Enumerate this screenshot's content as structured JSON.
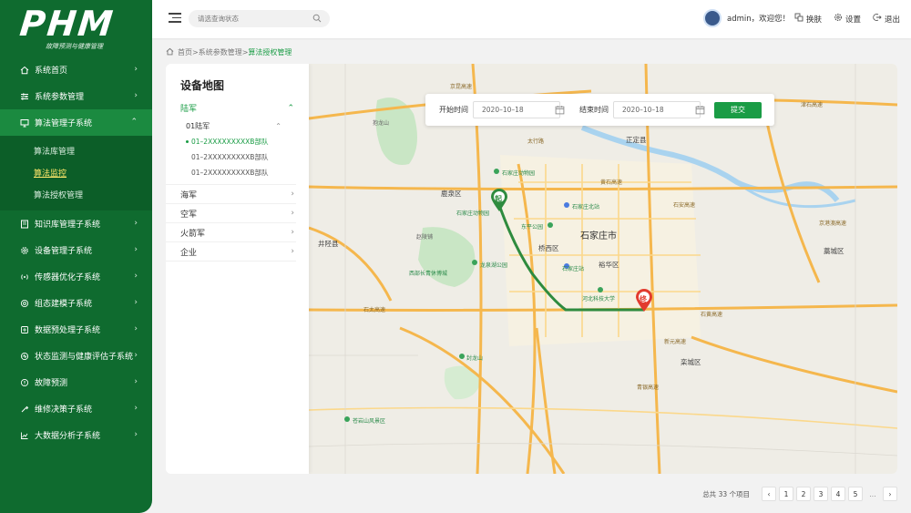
{
  "logo": {
    "text": "PHM",
    "subtitle": "故障预测与健康管理"
  },
  "sidebar": {
    "items": [
      {
        "label": "系统首页",
        "icon": "home-icon"
      },
      {
        "label": "系统参数管理",
        "icon": "sliders-icon"
      },
      {
        "label": "算法管理子系统",
        "icon": "monitor-icon",
        "active": true,
        "children": [
          {
            "label": "算法库管理"
          },
          {
            "label": "算法监控",
            "current": true
          },
          {
            "label": "算法授权管理"
          }
        ]
      },
      {
        "label": "知识库管理子系统",
        "icon": "book-icon"
      },
      {
        "label": "设备管理子系统",
        "icon": "gear-icon"
      },
      {
        "label": "传感器优化子系统",
        "icon": "signal-icon"
      },
      {
        "label": "组态建模子系统",
        "icon": "target-icon"
      },
      {
        "label": "数据预处理子系统",
        "icon": "database-icon"
      },
      {
        "label": "状态监测与健康评估子系统",
        "icon": "monitor-heart-icon"
      },
      {
        "label": "故障预测",
        "icon": "warning-icon"
      },
      {
        "label": "维修决策子系统",
        "icon": "wrench-icon"
      },
      {
        "label": "大数据分析子系统",
        "icon": "chart-icon"
      }
    ]
  },
  "topbar": {
    "search_placeholder": "请选查询状态",
    "user_greeting": "admin，欢迎您！",
    "skin_label": "换肤",
    "settings_label": "设置",
    "logout_label": "退出"
  },
  "breadcrumb": {
    "home": "首页",
    "sep": ">",
    "level1": "系统参数管理",
    "current": "算法授权管理"
  },
  "panel": {
    "title": "设备地图",
    "army": "陆军",
    "army_sub": "01陆军",
    "units": [
      "01–2XXXXXXXXXB部队",
      "01–2XXXXXXXXXB部队",
      "01–2XXXXXXXXXB部队"
    ],
    "others": [
      "海军",
      "空军",
      "火箭军",
      "企业"
    ]
  },
  "filter": {
    "start_label": "开始时间",
    "start_value": "2020–10–18",
    "end_label": "结束时间",
    "end_value": "2020–10–18",
    "submit": "提交"
  },
  "map": {
    "city": "石家庄市",
    "start_marker": "起",
    "end_marker": "终",
    "labels": {
      "beijing_kunming": "京昆高速",
      "shijiazhuang_north": "石家庄北站",
      "train_station": "石家庄站",
      "zoo": "石家庄动物园",
      "zoo2": "石家庄动物园",
      "qiaoxi": "桥西区",
      "yuhua": "裕华区",
      "luquan": "鹿泉区",
      "zhengding": "正定县",
      "gaocheng": "藁城区",
      "luancheng": "栾城区",
      "jingxing": "井陉县",
      "huangshi": "黄石高速",
      "shihuang": "石黄高速",
      "xinyuan": "新元高速",
      "qingyin": "青银高速",
      "shitai": "石太高速",
      "jinshi": "津石高速",
      "shiankao": "石安高速",
      "baolong": "抱龙山",
      "zhaolinge": "赵陵铺",
      "longquan": "龙泉湖公园",
      "dongping": "东平公园",
      "xibai": "西部长青休博城",
      "hebei_tech": "河北科技大学",
      "fenglong": "封龙山",
      "baiyan": "苍岩山风景区",
      "jingjing": "京港澳高速",
      "taihang": "太行路"
    }
  },
  "pagination": {
    "total": "总共 33 个项目",
    "pages": [
      "1",
      "2",
      "3",
      "4",
      "5"
    ],
    "ellipsis": "...",
    "prev": "‹",
    "next": "›"
  },
  "colors": {
    "primary": "#0f6b2f",
    "accent": "#1a9c45",
    "route": "#2e8b3e",
    "end_marker": "#e23b2e"
  }
}
